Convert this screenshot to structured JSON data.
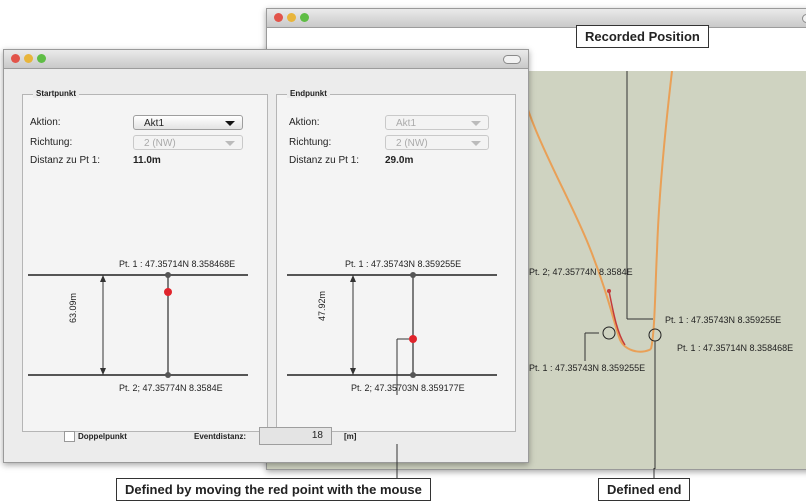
{
  "callouts": {
    "recorded_position": "Recorded Position",
    "defined_by_moving": "Defined by moving the red point with the mouse",
    "defined_end": "Defined end"
  },
  "map": {
    "labels": {
      "pt2": "Pt. 2; 47.35774N 8.3584E",
      "pt1_right": "Pt. 1 : 47.35743N 8.359255E",
      "pt1_far_right": "Pt. 1 : 47.35714N 8.358468E",
      "pt1_bottom": "Pt. 1 : 47.35743N 8.359255E"
    },
    "colors": {
      "track": "#e9a057",
      "background": "#cfd3c1"
    }
  },
  "startpunkt": {
    "title": "Startpunkt",
    "aktion_label": "Aktion:",
    "aktion_value": "Akt1",
    "richtung_label": "Richtung:",
    "richtung_value": "2 (NW)",
    "distanz_label": "Distanz zu Pt 1:",
    "distanz_value": "11.0m",
    "pt1_label": "Pt. 1 : 47.35714N 8.358468E",
    "pt2_label": "Pt. 2; 47.35774N 8.3584E",
    "dimension": "63.09m"
  },
  "endpunkt": {
    "title": "Endpunkt",
    "aktion_label": "Aktion:",
    "aktion_value": "Akt1",
    "richtung_label": "Richtung:",
    "richtung_value": "2 (NW)",
    "distanz_label": "Distanz zu Pt 1:",
    "distanz_value": "29.0m",
    "pt1_label": "Pt. 1 : 47.35743N 8.359255E",
    "pt2_label": "Pt. 2; 47.35703N 8.359177E",
    "dimension": "47.92m"
  },
  "footer": {
    "doppelpunkt_label": "Doppelpunkt",
    "eventdistanz_label": "Eventdistanz:",
    "eventdistanz_value": "18",
    "unit": "[m]"
  }
}
